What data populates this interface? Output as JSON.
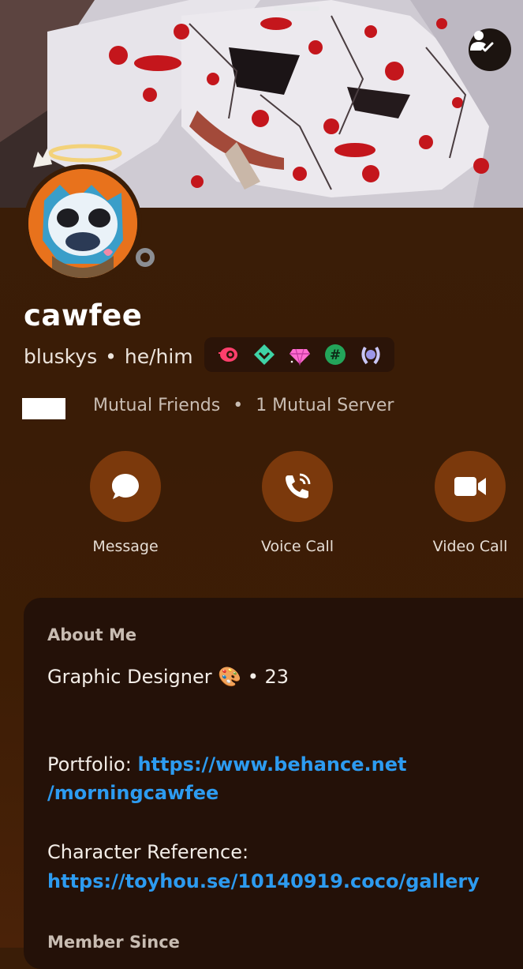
{
  "profile": {
    "display_name": "cawfee",
    "username": "bluskys",
    "separator": "•",
    "pronouns": "he/him"
  },
  "badges": [
    {
      "name": "nitro-badge-icon",
      "color": "#ff3f6c"
    },
    {
      "name": "hypesquad-balance-icon",
      "color": "#3fd3a6"
    },
    {
      "name": "server-boost-gem-icon",
      "color": "#ff6bd0"
    },
    {
      "name": "hashtag-badge-icon",
      "color": "#23a55a"
    },
    {
      "name": "quest-laurel-icon",
      "color": "#c9c6f5"
    }
  ],
  "mutuals": {
    "friends_text": "Mutual Friends",
    "dot": "•",
    "servers_text": "1 Mutual Server"
  },
  "actions": {
    "message_label": "Message",
    "voice_label": "Voice Call",
    "video_label": "Video Call"
  },
  "about": {
    "title": "About Me",
    "line1": "Graphic Designer 🎨 • 23",
    "portfolio_label": "Portfolio: ",
    "portfolio_link_part1": "https://www.behance.net",
    "portfolio_link_part2": "/morningcawfee",
    "character_label": "Character Reference:",
    "character_link": "https://toyhou.se/10140919.coco/gallery",
    "member_since_title": "Member Since"
  },
  "colors": {
    "page_bg": "#3a1d07",
    "action_button": "#7b390c",
    "card_bg": "#241108",
    "link": "#2d9bf0",
    "status_offline": "#8b8e93"
  }
}
